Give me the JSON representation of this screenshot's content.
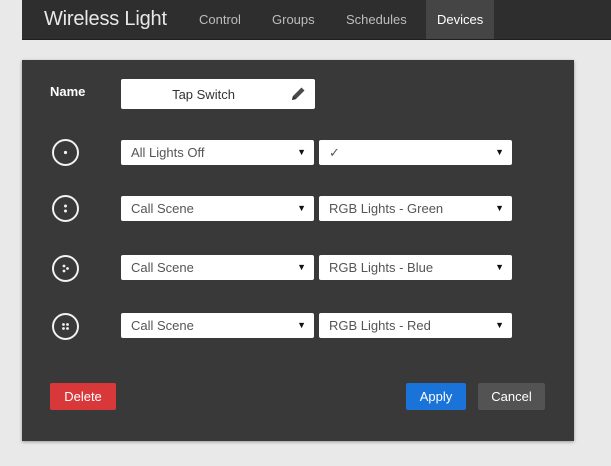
{
  "app": {
    "brand": "Wireless Light"
  },
  "nav": {
    "tabs": [
      {
        "label": "Control"
      },
      {
        "label": "Groups"
      },
      {
        "label": "Schedules"
      },
      {
        "label": "Devices",
        "active": true
      }
    ]
  },
  "device": {
    "name_label": "Name",
    "name_value": "Tap Switch",
    "buttons": [
      {
        "icon": "tap-button-1-dot-icon",
        "action": "All Lights Off",
        "param": "✓"
      },
      {
        "icon": "tap-button-2-dots-icon",
        "action": "Call Scene",
        "param": "RGB Lights - Green"
      },
      {
        "icon": "tap-button-3-dots-icon",
        "action": "Call Scene",
        "param": "RGB Lights - Blue"
      },
      {
        "icon": "tap-button-4-dots-icon",
        "action": "Call Scene",
        "param": "RGB Lights - Red"
      }
    ]
  },
  "actions": {
    "delete": "Delete",
    "apply": "Apply",
    "cancel": "Cancel"
  },
  "colors": {
    "panel": "#393939",
    "navbar": "#2e2e2e",
    "delete": "#d9383a",
    "apply": "#1a73d9",
    "cancel": "#535353"
  }
}
